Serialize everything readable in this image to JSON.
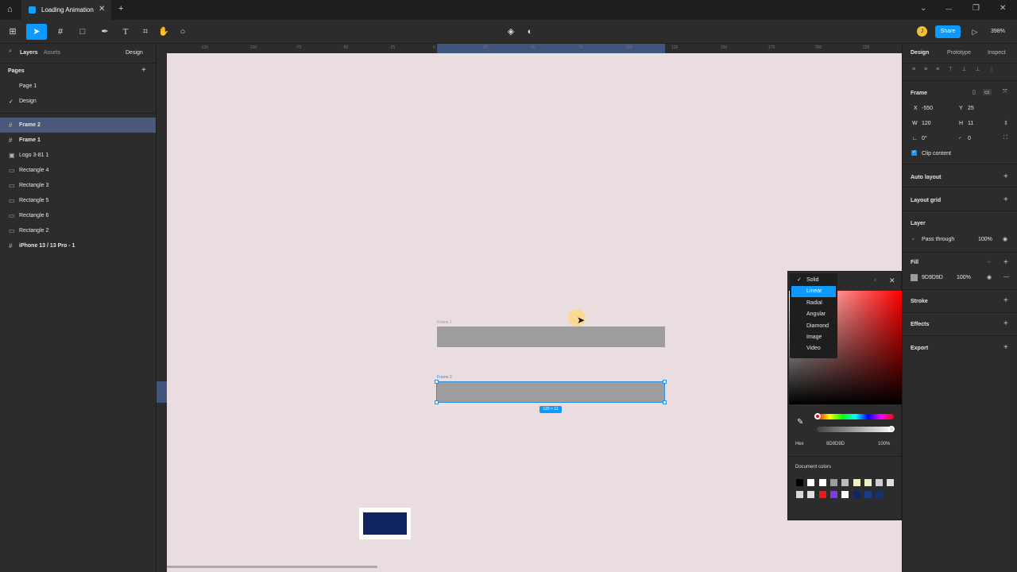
{
  "titlebar": {
    "tab_title": "Loading Animation",
    "close": "✕",
    "new_tab": "+",
    "win_min": "—",
    "win_max": "❐",
    "win_close": "✕",
    "chevron": "⌄"
  },
  "toolbar": {
    "share_label": "Share",
    "zoom": "398%",
    "avatar_initial": "J"
  },
  "left": {
    "tab_layers": "Layers",
    "tab_assets": "Assets",
    "design_dropdown": "Design",
    "pages_title": "Pages",
    "pages": [
      "Page 1",
      "Design"
    ],
    "layers": [
      "Frame 2",
      "Frame 1",
      "Logo 3-81 1",
      "Rectangle 4",
      "Rectangle 3",
      "Rectangle 5",
      "Rectangle 6",
      "Rectangle 2",
      "iPhone 13 / 13 Pro - 1"
    ]
  },
  "ruler": {
    "top": [
      "-125",
      "-100",
      "-75",
      "-50",
      "-25",
      "0",
      "25",
      "50",
      "75",
      "100",
      "120",
      "150",
      "175",
      "200",
      "225"
    ]
  },
  "canvas": {
    "frame1_label": "Frame 1",
    "frame2_label": "Frame 2",
    "dim_badge": "120 × 11"
  },
  "picker": {
    "types": [
      "Solid",
      "Linear",
      "Radial",
      "Angular",
      "Diamond",
      "Image",
      "Video"
    ],
    "selected_type": "Solid",
    "hover_type": "Linear",
    "hex_label": "Hex",
    "hex_value": "9D9D9D",
    "opacity": "100%",
    "doc_colors_label": "Document colors",
    "doc_colors": [
      "#000000",
      "#ffffff",
      "#ffffff",
      "#9d9d9d",
      "#bdbdbd",
      "#eef2c0",
      "#e8f0c8",
      "#cfcfcf",
      "#e0e0e0",
      "#d8d8d8",
      "#e0e0e0",
      "#e02020",
      "#7a3fd6",
      "#ffffff",
      "#0f2460",
      "#1a3a8a",
      "#163070"
    ]
  },
  "right": {
    "tabs": [
      "Design",
      "Prototype",
      "Inspect"
    ],
    "frame_label": "Frame",
    "x_label": "X",
    "x": "-550",
    "y_label": "Y",
    "y": "25",
    "w_label": "W",
    "w": "120",
    "h_label": "H",
    "h": "11",
    "rotation": "0°",
    "radius": "0",
    "clip_content": "Clip content",
    "auto_layout": "Auto layout",
    "layout_grid": "Layout grid",
    "layer_title": "Layer",
    "blend": "Pass through",
    "layer_opacity": "100%",
    "fill_title": "Fill",
    "fill_hex": "9D9D9D",
    "fill_opacity": "100%",
    "stroke": "Stroke",
    "effects": "Effects",
    "export": "Export"
  },
  "colors": {
    "accent": "#0d99ff",
    "canvas_bg": "#eadde0",
    "bar": "#9d9d9d",
    "logo": "#0f2460",
    "selection": "#4a5879"
  }
}
